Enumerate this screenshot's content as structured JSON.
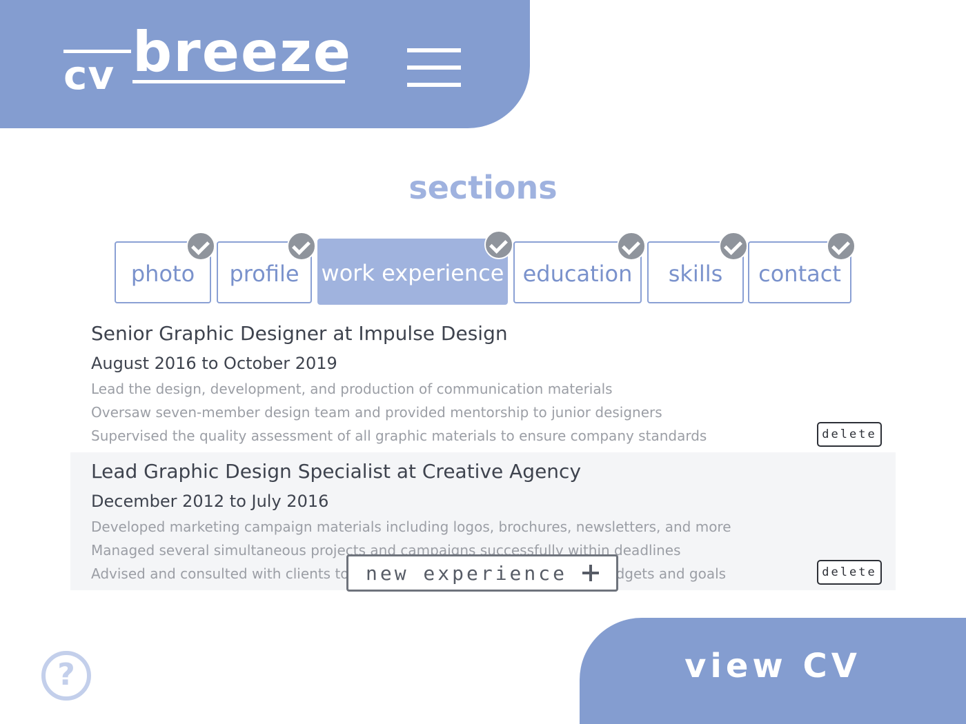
{
  "logo": {
    "cv": "cv",
    "breeze": "breeze"
  },
  "sections_title": "sections",
  "tabs": [
    {
      "label": "photo",
      "done": true,
      "active": false
    },
    {
      "label": "profile",
      "done": true,
      "active": false
    },
    {
      "label": "work experience",
      "done": true,
      "active": true
    },
    {
      "label": "education",
      "done": true,
      "active": false
    },
    {
      "label": "skills",
      "done": true,
      "active": false
    },
    {
      "label": "contact",
      "done": true,
      "active": false
    }
  ],
  "experiences": [
    {
      "title": "Senior Graphic Designer at Impulse Design",
      "dates": "August 2016 to October 2019",
      "bullets": [
        "Lead the design, development, and production of communication materials",
        "Oversaw seven-member design team and provided mentorship to junior designers",
        "Supervised the quality assessment of all graphic materials to ensure company standards"
      ],
      "delete_label": "delete"
    },
    {
      "title": "Lead Graphic Design Specialist at Creative Agency",
      "dates": "December 2012 to July 2016",
      "bullets": [
        "Developed marketing campaign materials including logos, brochures, newsletters, and more",
        "Managed several simultaneous projects and campaigns successfully within deadlines",
        "Advised and consulted with clients to determine design strategies within budgets and goals"
      ],
      "delete_label": "delete"
    }
  ],
  "new_experience_label": "new experience",
  "help_label": "?",
  "view_cv_label": "view CV",
  "colors": {
    "brand": "#849dd0",
    "tab_active": "#a0b3de",
    "check_badge": "#8f949c"
  }
}
